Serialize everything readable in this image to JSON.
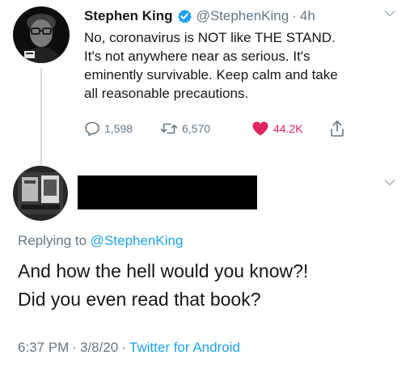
{
  "tweet1": {
    "author_name": "Stephen King",
    "handle": "@StephenKing",
    "separator": "·",
    "time_ago": "4h",
    "text_lines": [
      "No, coronavirus is NOT like THE STAND.",
      "It's not anywhere near as serious. It's",
      "eminently survivable. Keep calm and take",
      "all reasonable precautions."
    ],
    "replies": "1,598",
    "retweets": "6,570",
    "likes": "44.2K",
    "icons": {
      "verified": "verified-badge-icon",
      "reply": "reply-icon",
      "retweet": "retweet-icon",
      "like": "heart-icon",
      "share": "share-icon",
      "more": "chevron-down-icon"
    }
  },
  "tweet2": {
    "replying_to_label": "Replying to",
    "replying_to_handle": "@StephenKing",
    "text_lines": [
      "And how the hell would you know?!",
      "Did you even read that book?"
    ],
    "time": "6:37 PM",
    "date": "3/8/20",
    "separator": "·",
    "source": "Twitter for Android"
  },
  "colors": {
    "twitter_blue": "#1da1f2",
    "gray_text": "#657786",
    "like_red": "#e0245e",
    "text": "#14171a"
  }
}
